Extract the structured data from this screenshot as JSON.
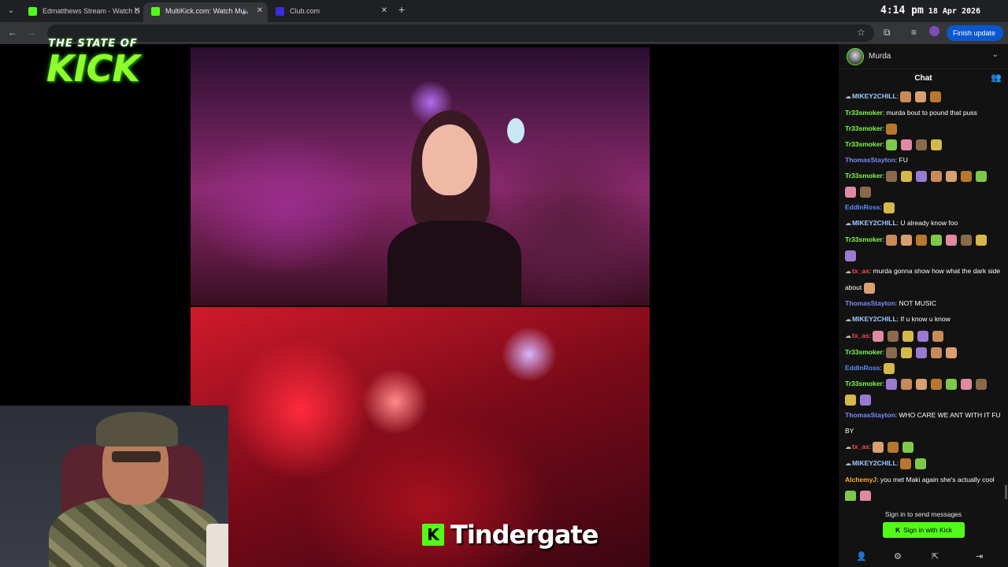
{
  "browser": {
    "tabs": [
      {
        "title": "Edmatthews Stream - Watch Li",
        "favicon_color": "#53fc18",
        "active": false
      },
      {
        "title": "MultiKick.com: Watch Multi",
        "favicon_color": "#53fc18",
        "active": true
      },
      {
        "title": "Club.com",
        "favicon_color": "#3b2bd9",
        "active": false
      }
    ],
    "finish_update_label": "Finish update"
  },
  "clock": {
    "time": "4:14 pm",
    "date": "18 Apr 2026"
  },
  "overlay": {
    "logo_top": "THE STATE OF",
    "logo_main": "KICK"
  },
  "subtitle": {
    "badge": "K",
    "text": "Tindergate"
  },
  "chat": {
    "channel": "Murda",
    "title": "Chat",
    "signin_prompt": "Sign in to send messages",
    "signin_button": "Sign in with Kick",
    "messages": [
      {
        "badge": "☁",
        "user": "MIKEY2CHILL",
        "color": "#9ec9ff",
        "text": "",
        "emotes": 3
      },
      {
        "badge": "",
        "user": "Tr33smoker",
        "color": "#7cff4d",
        "text": "murda bout to pound that puss",
        "emotes": 0
      },
      {
        "badge": "",
        "user": "Tr33smoker",
        "color": "#7cff4d",
        "text": "",
        "emotes": 1
      },
      {
        "badge": "",
        "user": "Tr33smoker",
        "color": "#7cff4d",
        "text": "",
        "emotes": 4
      },
      {
        "badge": "",
        "user": "ThomasStayton",
        "color": "#7a8cff",
        "text": "FU",
        "emotes": 0
      },
      {
        "badge": "",
        "user": "Tr33smoker",
        "color": "#7cff4d",
        "text": "",
        "emotes": 9
      },
      {
        "badge": "",
        "user": "EddInRoss",
        "color": "#5e8cff",
        "text": "",
        "emotes": 1
      },
      {
        "badge": "☁",
        "user": "MIKEY2CHILL",
        "color": "#9ec9ff",
        "text": "U already know foo",
        "emotes": 0
      },
      {
        "badge": "",
        "user": "Tr33smoker",
        "color": "#7cff4d",
        "text": "",
        "emotes": 8
      },
      {
        "badge": "☁",
        "user": "tx_as",
        "color": "#ff4a4a",
        "text": "murda gonna show how what the dark side about",
        "emotes": 1
      },
      {
        "badge": "",
        "user": "ThomasStayton",
        "color": "#7a8cff",
        "text": "NOT MUSIC",
        "emotes": 0
      },
      {
        "badge": "☁",
        "user": "MIKEY2CHILL",
        "color": "#9ec9ff",
        "text": "If u know u know",
        "emotes": 0
      },
      {
        "badge": "☁",
        "user": "tx_as",
        "color": "#ff4a4a",
        "text": "",
        "emotes": 5
      },
      {
        "badge": "",
        "user": "Tr33smoker",
        "color": "#7cff4d",
        "text": "",
        "emotes": 5
      },
      {
        "badge": "",
        "user": "EddInRoss",
        "color": "#5e8cff",
        "text": "",
        "emotes": 1
      },
      {
        "badge": "",
        "user": "Tr33smoker",
        "color": "#7cff4d",
        "text": "",
        "emotes": 9
      },
      {
        "badge": "",
        "user": "ThomasStayton",
        "color": "#7a8cff",
        "text": "WHO CARE WE ANT WITH IT FU BY",
        "emotes": 0
      },
      {
        "badge": "☁",
        "user": "tx_as",
        "color": "#ff4a4a",
        "text": "",
        "emotes": 3
      },
      {
        "badge": "☁",
        "user": "MIKEY2CHILL",
        "color": "#9ec9ff",
        "text": "",
        "emotes": 2
      },
      {
        "badge": "",
        "user": "AlchemyJ",
        "color": "#ffb02e",
        "text": "you met Maki again she's actually cool",
        "emotes": 2
      }
    ]
  },
  "colors": {
    "kick_green": "#53fc18",
    "chat_bg": "#121212",
    "chrome_bg": "#35363a"
  },
  "icons": [
    "back-icon",
    "forward-icon",
    "star-icon",
    "extensions-icon",
    "media-icon",
    "profile-icon",
    "users-icon",
    "settings-icon",
    "popout-icon",
    "add-user-icon",
    "exit-icon"
  ]
}
